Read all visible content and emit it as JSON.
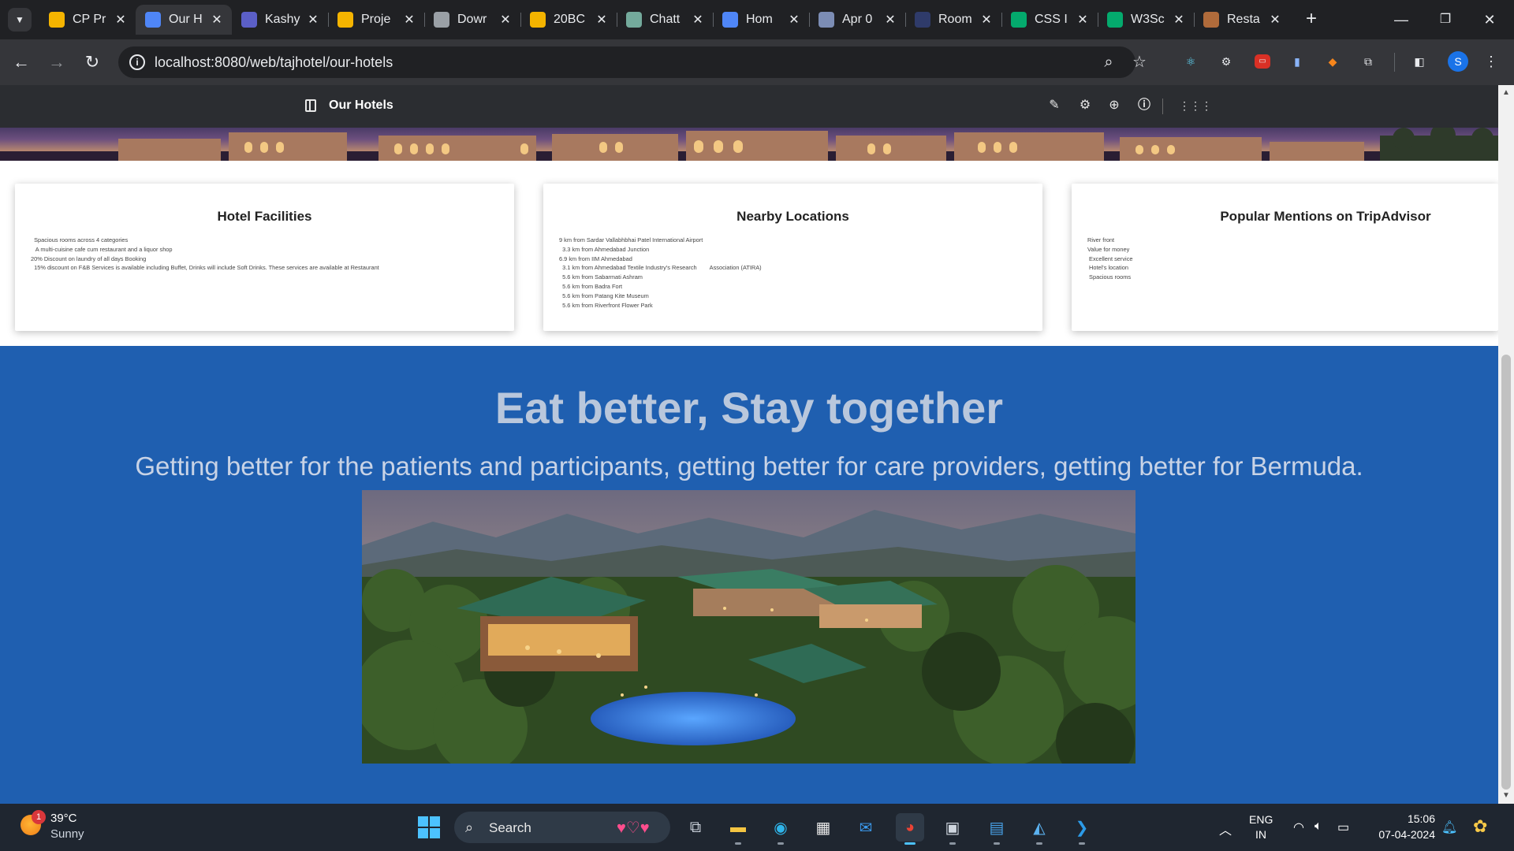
{
  "browser": {
    "tabs": [
      {
        "title": "CP Pr",
        "favicon_color": "#f4b400",
        "active": false
      },
      {
        "title": "Our H",
        "favicon_color": "#4f86f7",
        "active": true
      },
      {
        "title": "Kashy",
        "favicon_color": "#5b5fc7",
        "active": false
      },
      {
        "title": "Proje",
        "favicon_color": "#f4b400",
        "active": false
      },
      {
        "title": "Dowr",
        "favicon_color": "#9aa0a6",
        "active": false
      },
      {
        "title": "20BC",
        "favicon_color": "#f4b400",
        "active": false
      },
      {
        "title": "Chatt",
        "favicon_color": "#74aa9c",
        "active": false
      },
      {
        "title": "Hom",
        "favicon_color": "#4f86f7",
        "active": false
      },
      {
        "title": "Apr 0",
        "favicon_color": "#7c8db5",
        "active": false
      },
      {
        "title": "Room",
        "favicon_color": "#2f3b6a",
        "active": false
      },
      {
        "title": "CSS I",
        "favicon_color": "#04aa6d",
        "active": false
      },
      {
        "title": "W3Sc",
        "favicon_color": "#04aa6d",
        "active": false
      },
      {
        "title": "Resta",
        "favicon_color": "#b06b3b",
        "active": false
      }
    ],
    "url": "localhost:8080/web/tajhotel/our-hotels",
    "profile_initial": "S"
  },
  "adminbar": {
    "title": "Our Hotels"
  },
  "cards": [
    {
      "title": "Hotel Facilities",
      "items": [
        "  Spacious rooms across 4 categories",
        "   A multi-cuisine cafe cum restaurant and a liquor shop",
        "20% Discount on laundry of all days Booking",
        "  15% discount on F&B Services is available including Buffet, Drinks will include Soft Drinks. These services are available at Restaurant"
      ]
    },
    {
      "title": "Nearby Locations",
      "items": [
        "9 km from Sardar Vallabhbhai Patel International Airport",
        "  3.3 km from Ahmedabad Junction",
        "6.9 km from IIM Ahmedabad",
        "  3.1 km from Ahmedabad Textile Industry's Research        Association (ATIRA)",
        "  5.6 km from Sabarmati Ashram",
        "  5.6 km from Badra Fort",
        "  5.6 km from Patang Kite Museum",
        "  5.6 km from Riverfront Flower Park"
      ]
    },
    {
      "title": "Popular Mentions on TripAdvisor",
      "items": [
        "River front",
        "Value for money",
        " Excellent service",
        " Hotel's location",
        " Spacious rooms"
      ]
    }
  ],
  "hero": {
    "title": "Eat better, Stay together",
    "subtitle": "Getting better for the patients and participants, getting better for care providers, getting better for Bermuda."
  },
  "taskbar": {
    "weather_temp": "39°C",
    "weather_condition": "Sunny",
    "weather_badge": "1",
    "search_label": "Search",
    "language": "ENG",
    "region": "IN",
    "time": "15:06",
    "date": "07-04-2024"
  }
}
